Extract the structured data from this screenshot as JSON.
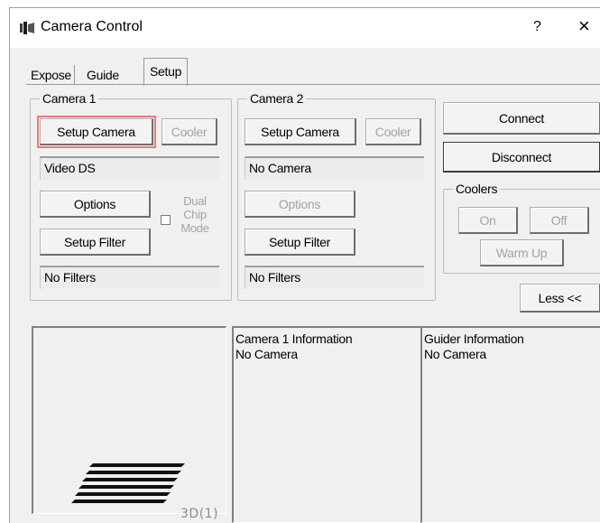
{
  "window": {
    "title": "Camera Control",
    "help": "?",
    "close": "×"
  },
  "tabs": [
    {
      "label": "Expose"
    },
    {
      "label": "Guide"
    },
    {
      "label": "Setup",
      "active": true
    }
  ],
  "camera1": {
    "legend": "Camera 1",
    "setup_camera": "Setup Camera",
    "cooler": "Cooler",
    "camera_name": "Video DS",
    "options": "Options",
    "dual_chip_mode": [
      "Dual",
      "Chip",
      "Mode"
    ],
    "setup_filter": "Setup Filter",
    "filter_name": "No Filters"
  },
  "camera2": {
    "legend": "Camera 2",
    "setup_camera": "Setup Camera",
    "cooler": "Cooler",
    "camera_name": "No Camera",
    "options": "Options",
    "setup_filter": "Setup Filter",
    "filter_name": "No Filters"
  },
  "connection": {
    "connect": "Connect",
    "disconnect": "Disconnect"
  },
  "coolers": {
    "legend": "Coolers",
    "on": "On",
    "off": "Off",
    "warm_up": "Warm Up"
  },
  "less_button": "Less <<",
  "preview": {
    "label": "3D(1)"
  },
  "camera1_info": {
    "heading": "Camera 1 Information",
    "status": "No Camera"
  },
  "guider_info": {
    "heading": "Guider Information",
    "status": "No Camera"
  },
  "colors": {
    "window_bg": "#f0f0f0",
    "focus_outline": "#e87a7a",
    "disabled_text": "#a3a3a3"
  }
}
